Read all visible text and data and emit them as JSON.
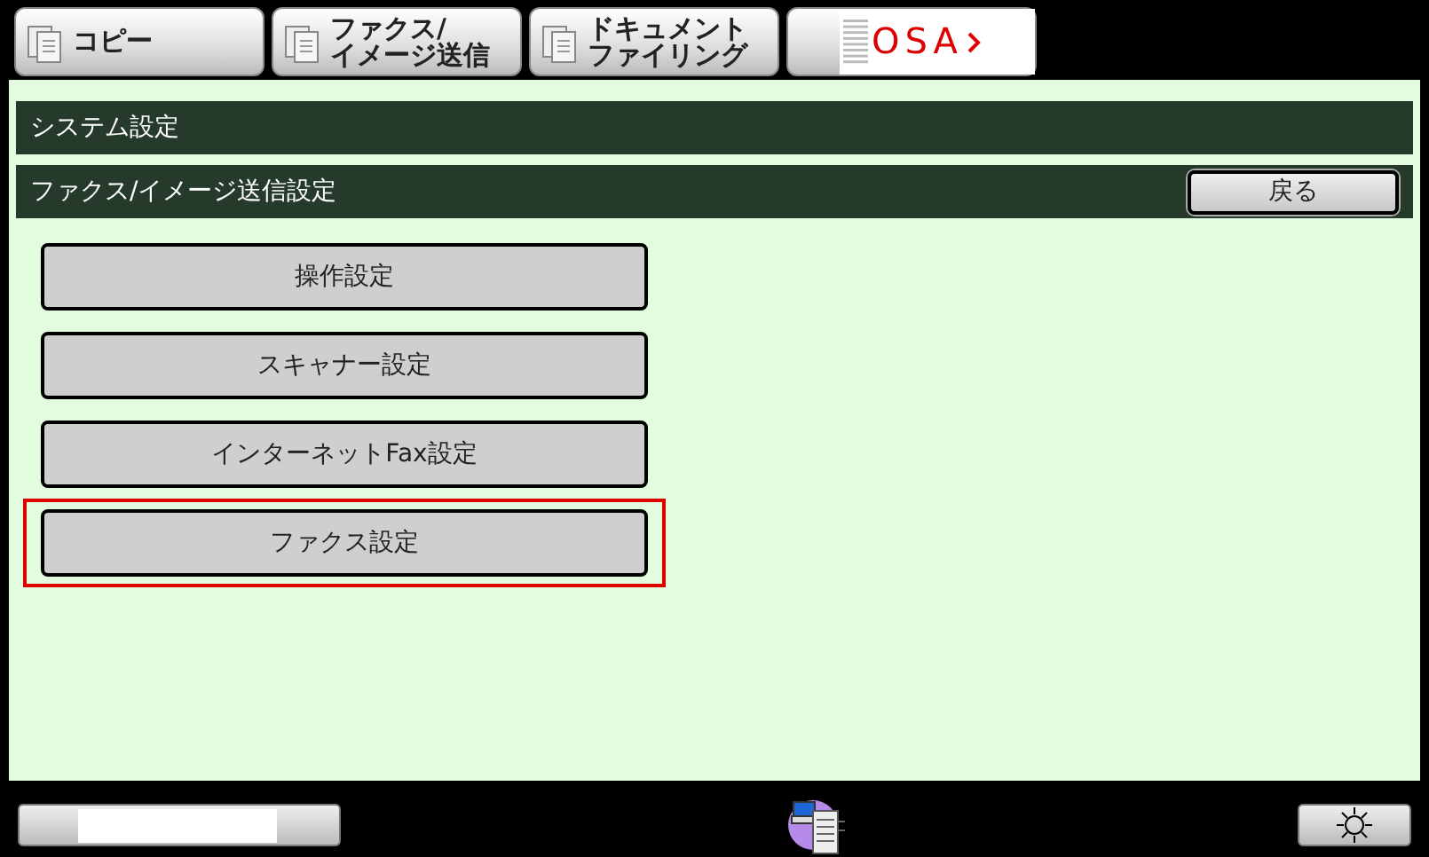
{
  "tabs": [
    {
      "kind": "copy",
      "lines": [
        "コピー"
      ]
    },
    {
      "kind": "copy",
      "lines": [
        "ファクス/",
        "イメージ送信"
      ]
    },
    {
      "kind": "copy",
      "lines": [
        "ドキュメント",
        "ファイリング"
      ]
    },
    {
      "kind": "logo",
      "label": "OSA"
    }
  ],
  "breadcrumb": {
    "title": "システム設定",
    "subtitle": "ファクス/イメージ送信設定",
    "back_button": "戻る"
  },
  "menu": [
    {
      "label": "操作設定",
      "highlighted": false
    },
    {
      "label": "スキャナー設定",
      "highlighted": false
    },
    {
      "label": "インターネットFax設定",
      "highlighted": false
    },
    {
      "label": "ファクス設定",
      "highlighted": true
    }
  ]
}
